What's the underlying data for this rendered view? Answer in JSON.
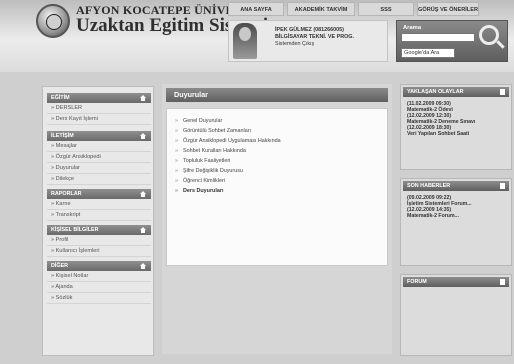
{
  "header": {
    "university": "AFYON KOCATEPE ÜNİVERSİTESİ",
    "system": "Uzaktan Egitim Sistemi"
  },
  "topnav": [
    "ANA SAYFA",
    "AKADEMİK TAKVİM",
    "SSS",
    "GÖRÜŞ VE ÖNERİLER"
  ],
  "user": {
    "name_line": "İPEK GÜLMEZ (081266005)",
    "program_line": "BİLGİSAYAR TEKNİ. VE PROG.",
    "logout": "Sistemden Çıkış"
  },
  "search": {
    "label": "Arama",
    "placeholder": "",
    "select_value": "Google'da Ara"
  },
  "sidebar": {
    "sections": [
      {
        "title": "EĞİTİM",
        "items": [
          "DERSLER",
          "Ders Kayıt İşlemi"
        ]
      },
      {
        "title": "İLETİŞİM",
        "items": [
          "Mesajlar",
          "Özgür Ansiklopedi",
          "Duyurular",
          "Dilekçe"
        ]
      },
      {
        "title": "RAPORLAR",
        "items": [
          "Karne",
          "Transkript"
        ]
      },
      {
        "title": "KİŞİSEL BİLGİLER",
        "items": [
          "Profil",
          "Kullanıcı İşlemleri"
        ]
      },
      {
        "title": "DİĞER",
        "items": [
          "Kişisel Notlar",
          "Ajanda",
          "Sözlük"
        ]
      }
    ]
  },
  "main": {
    "title": "Duyurular",
    "items": [
      "Genel Duyurular",
      "Görüntülü Sohbet Zamanları",
      "Özgür Ansiklopedi Uygulaması Hakkında",
      "Sohbet Kuralları Hakkında",
      "Topluluk Faaliyetleri",
      "Şifre Değişiklik Duyurusu",
      "Öğrenci Kimlikleri",
      "Ders Duyuruları"
    ]
  },
  "right": {
    "events_title": "YAKLAŞAN OLAYLAR",
    "events": [
      "(11.02.2009 09:30)",
      "Matematik-2 Ödevi",
      "(12.02.2009 12:30)",
      "Matematik-2 Deneme Sınavı",
      "(12.02.2009 18:30)",
      "Veri Yapıları Sohbet Saati"
    ],
    "news_title": "SON HABERLER",
    "news": [
      "(09.02.2009 09:22)",
      "İşletim Sistemleri Forum...",
      "(12.02.2009 14:35)",
      "Matematik-2 Forum..."
    ],
    "forum_title": "FORUM"
  }
}
